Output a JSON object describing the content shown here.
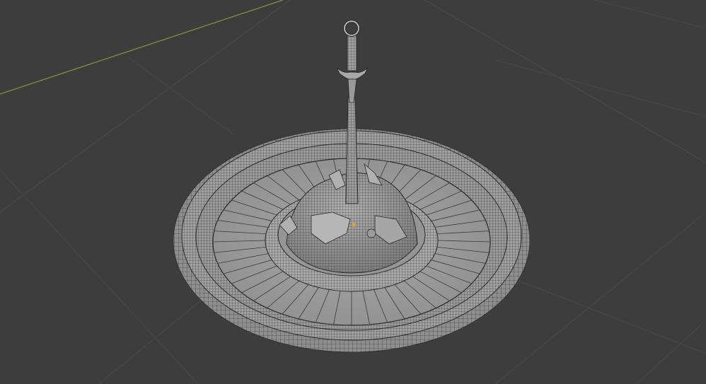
{
  "viewport": {
    "mode": "Object Mode",
    "shading": "solid-wireframe",
    "background_color": "#3d3d3d",
    "grid_color": "#4a4a4a",
    "x_axis_color": "#a34c4c",
    "y_axis_color": "#7a9a3a",
    "mesh_color": "#9a9a9a",
    "wire_color": "#2a2a2a",
    "origin_color": "#f29a30"
  },
  "scene": {
    "object": "sword-in-stone-fountain",
    "icons": [
      "origin-dot-icon"
    ]
  }
}
